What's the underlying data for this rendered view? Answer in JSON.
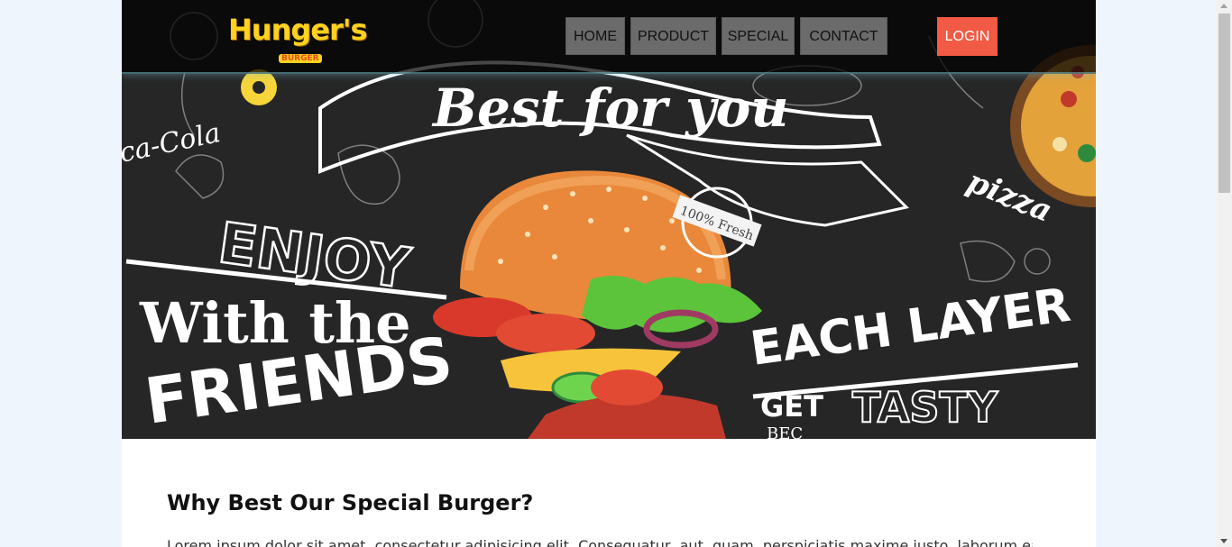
{
  "brand": {
    "name": "Hunger's",
    "sub": "BURGER",
    "color": "#ffd21f"
  },
  "nav": {
    "items": [
      {
        "label": "HOME"
      },
      {
        "label": "PRODUCT"
      },
      {
        "label": "SPECIAL"
      },
      {
        "label": "CONTACT"
      }
    ],
    "login_label": "LOGIN",
    "login_color": "#f15a44"
  },
  "hero": {
    "headline": "Best for you",
    "left_text_1": "ENJOY",
    "left_text_2": "With the",
    "left_text_3": "FRIENDS",
    "right_text_1": "EACH LAYER",
    "right_text_2": "GET",
    "right_text_3": "TASTY",
    "badge": "100% Fresh",
    "cola": "ca-Cola",
    "pizza": "pizza",
    "partial": "BEC"
  },
  "section": {
    "title": "Why Best Our Special Burger?",
    "text": "Lorem ipsum dolor sit amet, consectetur adipisicing elit. Consequatur, aut, quam, perspiciatis maxime iusto, laborum earum."
  },
  "icons": {
    "scroll_up": "chevron-up-icon",
    "scroll_down": "chevron-down-icon"
  }
}
